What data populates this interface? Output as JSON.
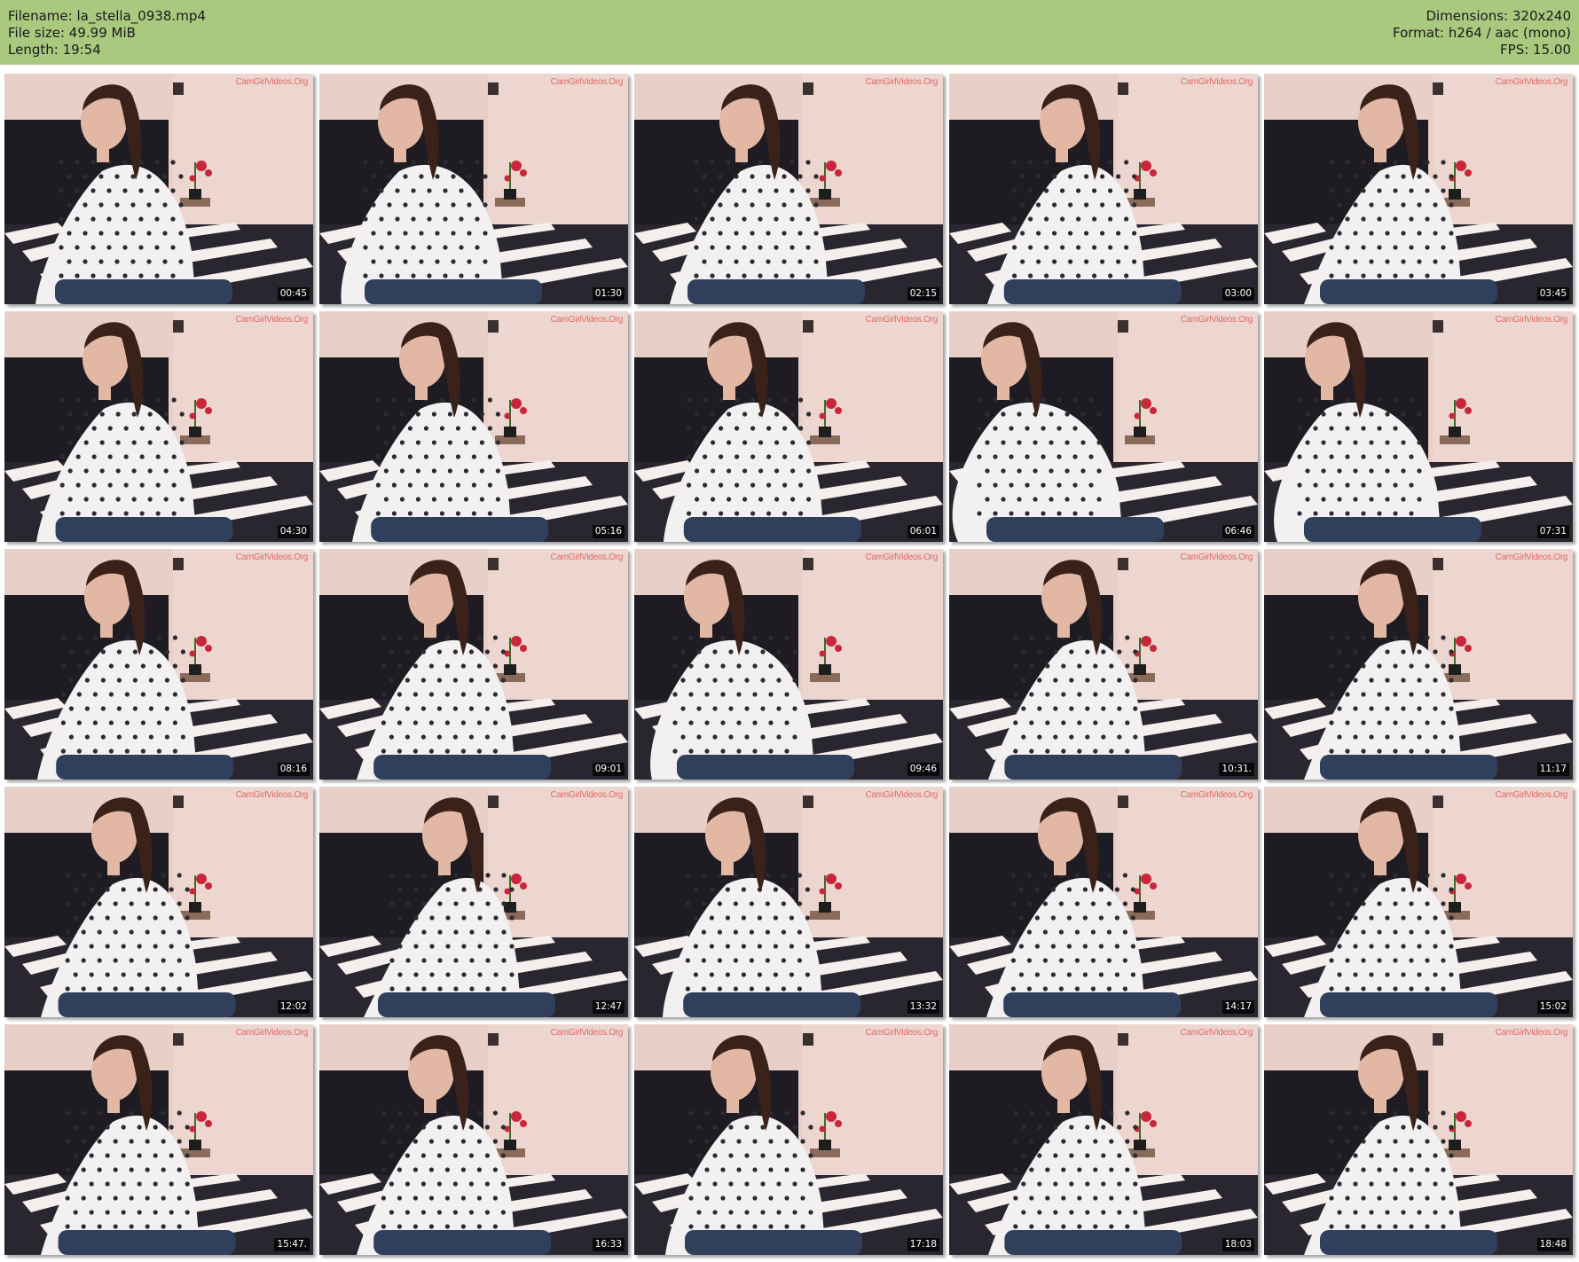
{
  "header": {
    "left": [
      {
        "label": "Filename:",
        "value": "la_stella_0938.mp4"
      },
      {
        "label": "File size:",
        "value": "49.99 MiB"
      },
      {
        "label": "Length:",
        "value": "19:54"
      }
    ],
    "right": [
      {
        "label": "Dimensions:",
        "value": "320x240"
      },
      {
        "label": "Format:",
        "value": "h264 / aac (mono)"
      },
      {
        "label": "FPS:",
        "value": "15.00"
      }
    ]
  },
  "watermark": "CamGirlVideos.Org",
  "thumbnails": [
    {
      "time": "00:45"
    },
    {
      "time": "01:30"
    },
    {
      "time": "02:15"
    },
    {
      "time": "03:00"
    },
    {
      "time": "03:45"
    },
    {
      "time": "04:30"
    },
    {
      "time": "05:16"
    },
    {
      "time": "06:01"
    },
    {
      "time": "06:46"
    },
    {
      "time": "07:31"
    },
    {
      "time": "08:16"
    },
    {
      "time": "09:01"
    },
    {
      "time": "09:46"
    },
    {
      "time": "10:31."
    },
    {
      "time": "11:17"
    },
    {
      "time": "12:02"
    },
    {
      "time": "12:47"
    },
    {
      "time": "13:32"
    },
    {
      "time": "14:17"
    },
    {
      "time": "15:02"
    },
    {
      "time": "15:47."
    },
    {
      "time": "16:33"
    },
    {
      "time": "17:18"
    },
    {
      "time": "18:03"
    },
    {
      "time": "18:48"
    }
  ],
  "colors": {
    "header_bg": "#a9c97f",
    "wall": "#e8cfc8",
    "headboard": "#1f1b22",
    "shirt": "#f2f0f0",
    "dots": "#2b2b33",
    "hair": "#3a221b",
    "skin": "#e2b8a4",
    "flower": "#c8263a",
    "jeans": "#2f3f5c"
  }
}
